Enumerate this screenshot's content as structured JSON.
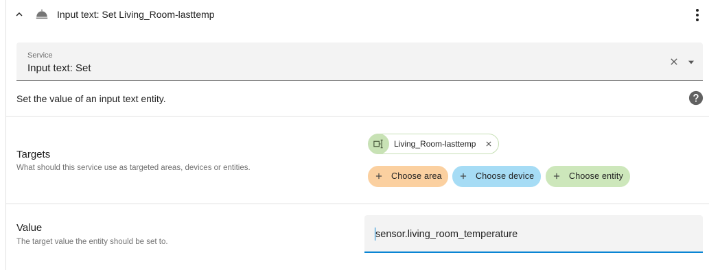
{
  "header": {
    "title": "Input text: Set Living_Room-lasttemp",
    "icons": {
      "collapse": "chevron-up-icon",
      "action": "room-service-icon",
      "menu": "dots-vertical-icon"
    }
  },
  "service": {
    "label": "Service",
    "value": "Input text: Set"
  },
  "description": "Set the value of an input text entity.",
  "targets": {
    "title": "Targets",
    "description": "What should this service use as targeted areas, devices or entities.",
    "selected_entity": "Living_Room-lasttemp",
    "add_area_label": "Choose area",
    "add_device_label": "Choose device",
    "add_entity_label": "Choose entity"
  },
  "value": {
    "title": "Value",
    "description": "The target value the entity should be set to.",
    "input_value": "sensor.living_room_temperature"
  },
  "colors": {
    "accent": "#0a85d4",
    "area_chip": "#fbd0a0",
    "device_chip": "#a6dcf5",
    "entity_chip": "#cde7bb"
  }
}
